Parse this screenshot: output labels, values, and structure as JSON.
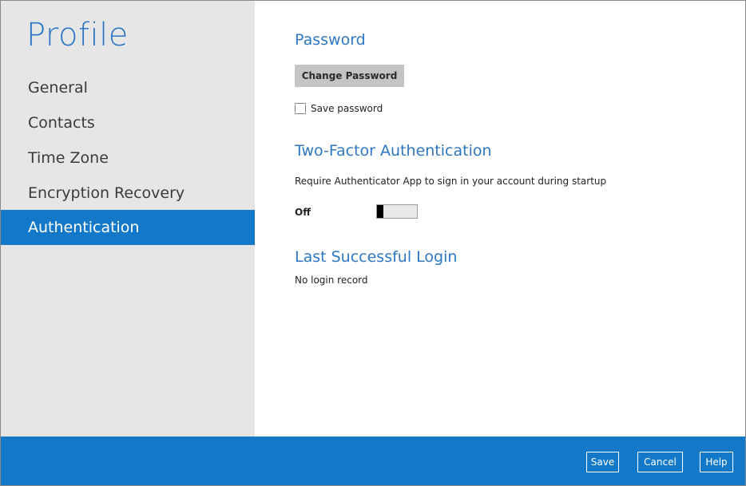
{
  "sidebar": {
    "title": "Profile",
    "items": [
      {
        "label": "General",
        "active": false
      },
      {
        "label": "Contacts",
        "active": false
      },
      {
        "label": "Time Zone",
        "active": false
      },
      {
        "label": "Encryption Recovery",
        "active": false
      },
      {
        "label": "Authentication",
        "active": true
      }
    ]
  },
  "password": {
    "title": "Password",
    "change_button": "Change Password",
    "save_password_label": "Save password",
    "save_password_checked": false
  },
  "two_factor": {
    "title": "Two-Factor Authentication",
    "description": "Require Authenticator App to sign in your account during startup",
    "state_label": "Off",
    "enabled": false
  },
  "last_login": {
    "title": "Last Successful Login",
    "value": "No login record"
  },
  "footer": {
    "save": "Save",
    "cancel": "Cancel",
    "help": "Help"
  },
  "colors": {
    "accent": "#1278c7",
    "title_blue": "#2d77c4",
    "sidebar_bg": "#e6e6e6"
  }
}
